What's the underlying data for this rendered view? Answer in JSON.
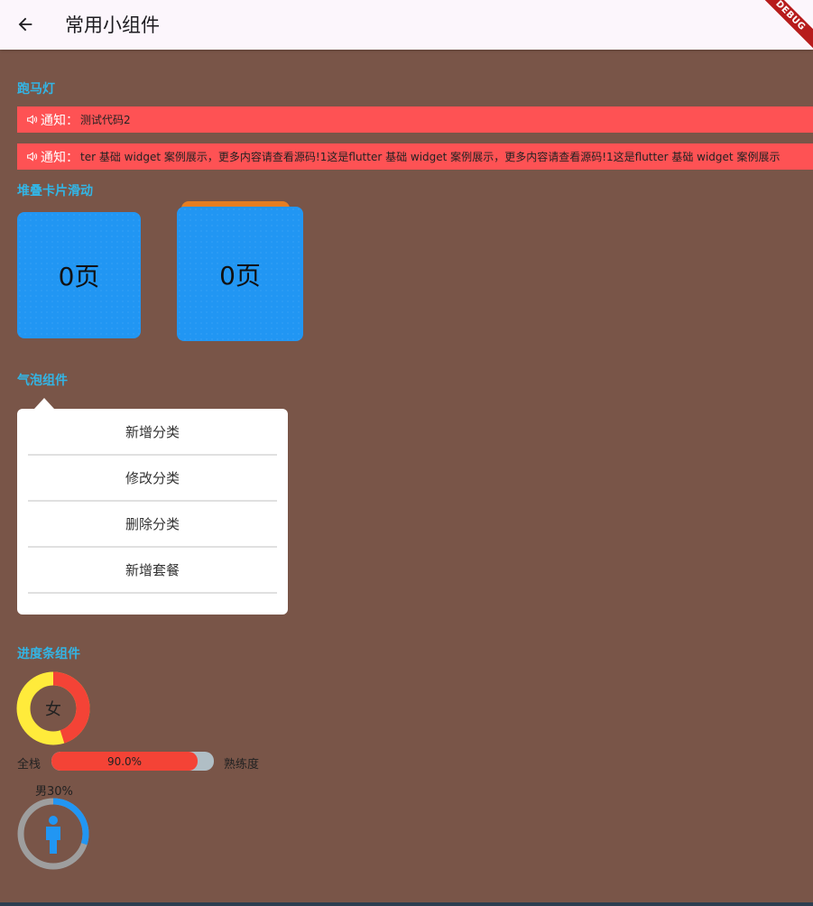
{
  "appbar": {
    "title": "常用小组件",
    "debug_badge": "DEBUG"
  },
  "sections": {
    "marquee_title": "跑马灯",
    "stack_title": "堆叠卡片滑动",
    "bubble_title": "气泡组件",
    "progress_title": "进度条组件"
  },
  "marquee": {
    "label": "通知：",
    "row1_text": "测试代码2",
    "row2_text": "ter 基础 widget 案例展示，更多内容请查看源码!1这是flutter 基础 widget 案例展示，更多内容请查看源码!1这是flutter 基础 widget 案例展示"
  },
  "cards": {
    "card1_text": "0页",
    "card2_text": "0页"
  },
  "bubble_menu": {
    "items": [
      "新增分类",
      "修改分类",
      "删除分类",
      "新增套餐"
    ]
  },
  "progress": {
    "ring1_label": "女",
    "ring1_value": 0.45,
    "bar_left_label": "全栈",
    "bar_right_label": "熟练度",
    "bar_value": 0.9,
    "bar_text": "90.0%",
    "ring2_label": "男30%",
    "ring2_value": 0.3,
    "icon": "person-icon"
  },
  "colors": {
    "background": "#795548",
    "accent_title": "#33b5e5",
    "marquee": "#fe5254",
    "card": "#2196f3",
    "ring1_fill": "#f44336",
    "ring1_track": "#ffeb3b",
    "ring2_fill": "#2196f3",
    "ring2_track": "#9e9e9e"
  }
}
